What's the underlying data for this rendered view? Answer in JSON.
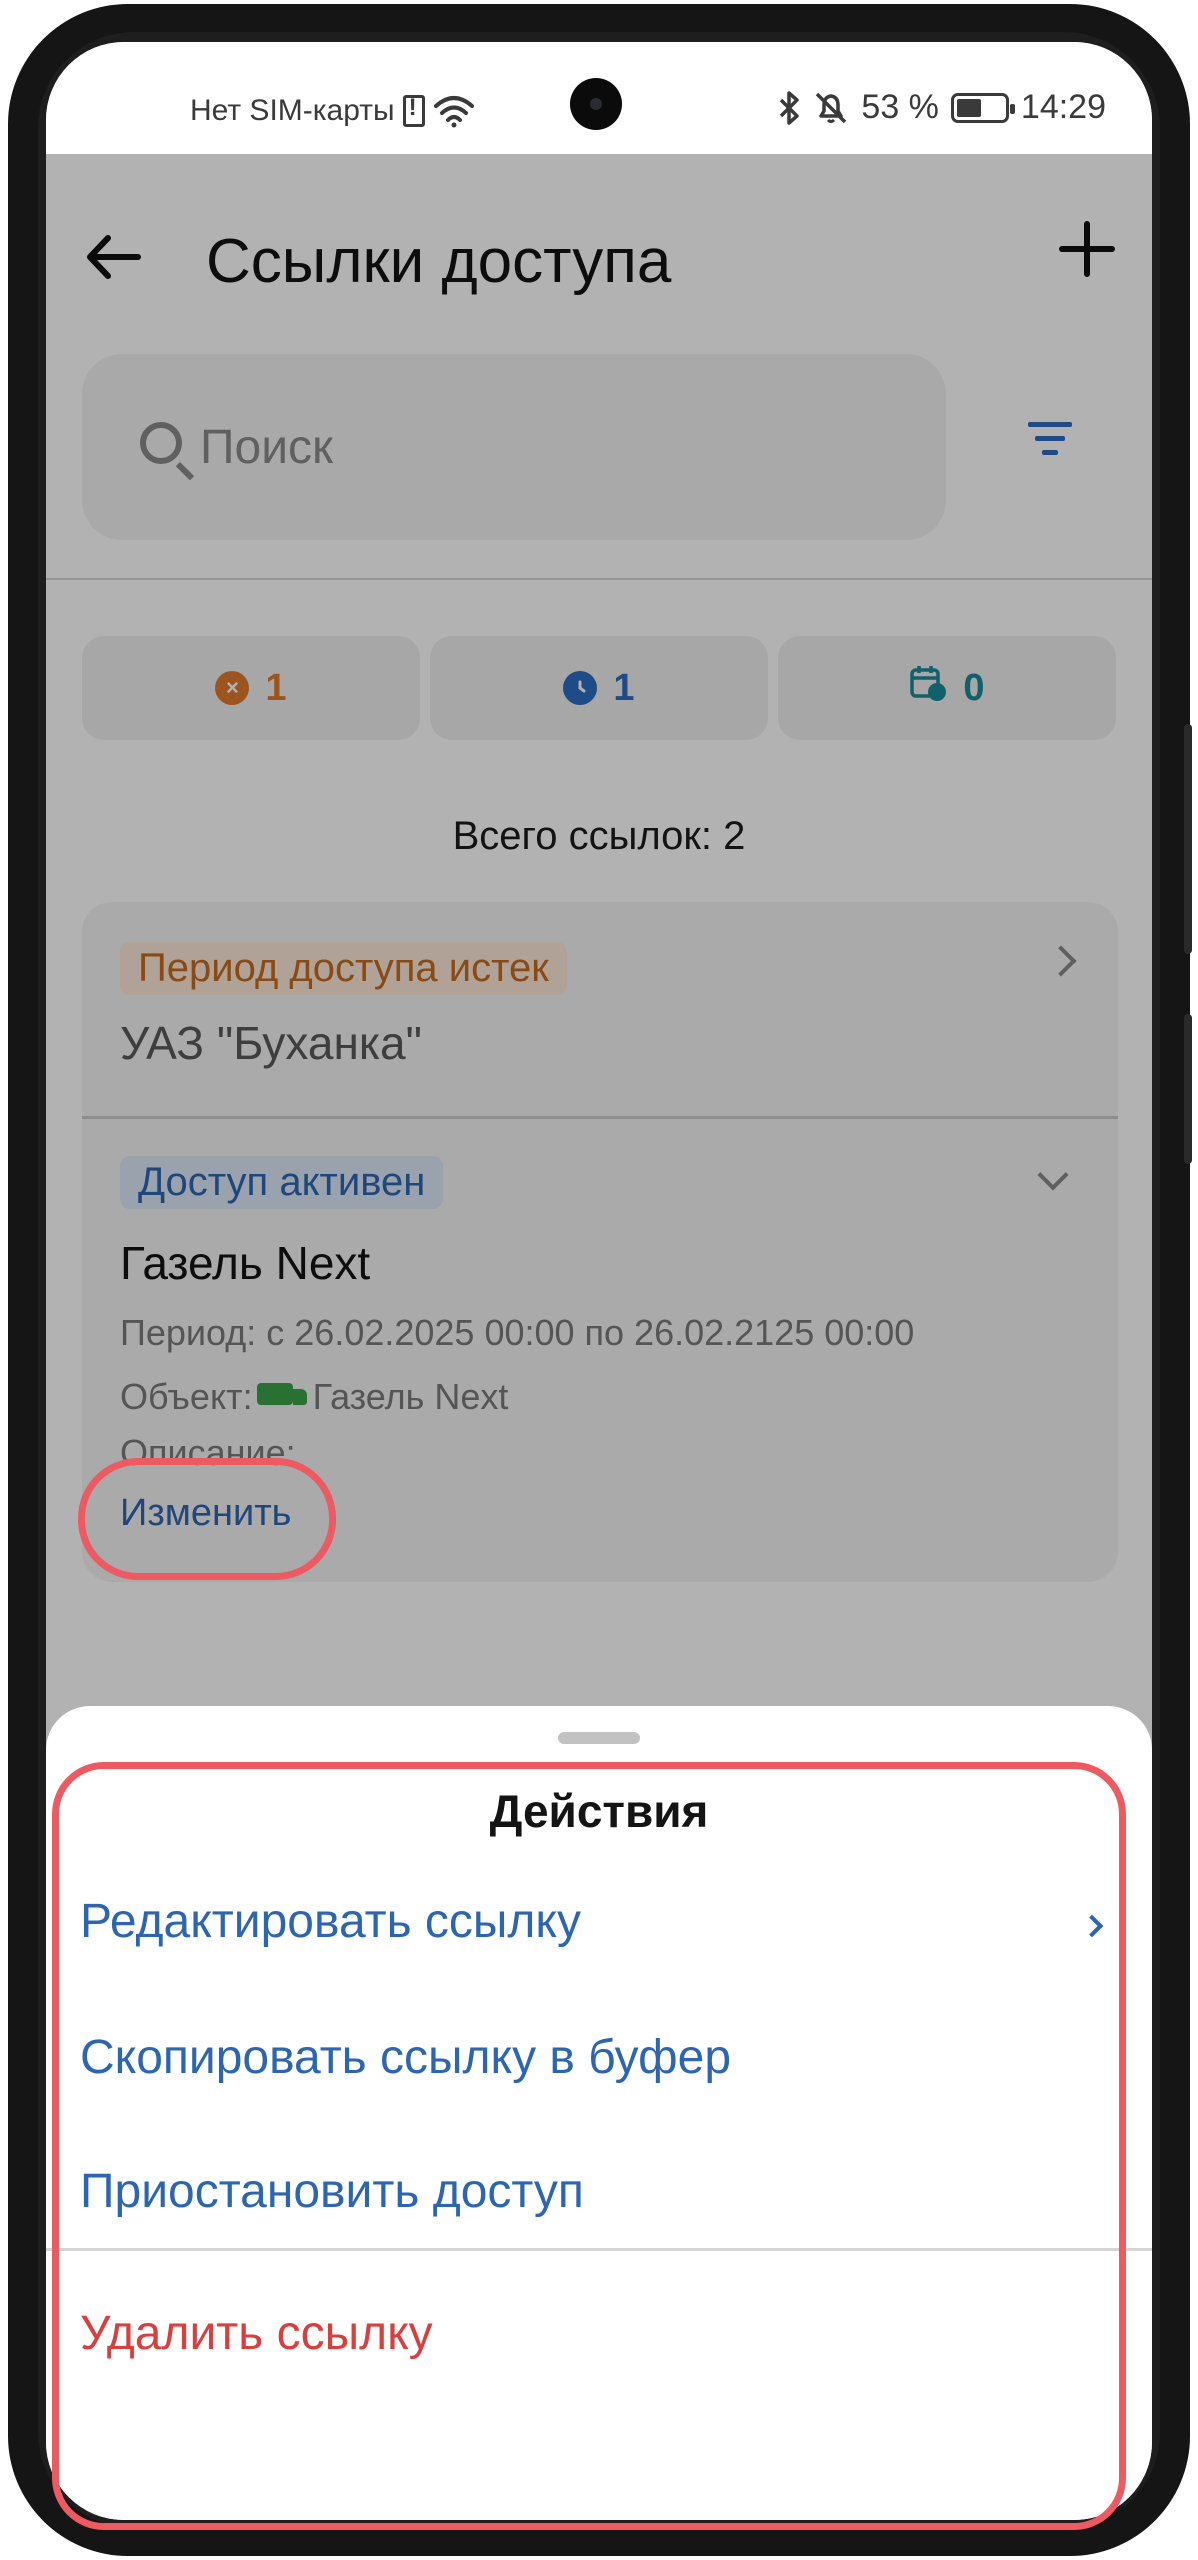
{
  "status_bar": {
    "carrier": "Нет SIM-карты",
    "battery": "53 %",
    "time": "14:29"
  },
  "header": {
    "title": "Ссылки доступа",
    "back_icon": "arrow-left-icon",
    "add_icon": "plus-icon"
  },
  "search": {
    "placeholder": "Поиск"
  },
  "counters": [
    {
      "icon": "x-circle-icon",
      "value": "1",
      "color": "#e07a2b"
    },
    {
      "icon": "clock-icon",
      "value": "1",
      "color": "#2d6cc0"
    },
    {
      "icon": "calendar-clock-icon",
      "value": "0",
      "color": "#1a8c98"
    }
  ],
  "total": "Всего ссылок: 2",
  "links": [
    {
      "status": "Период доступа истек",
      "name": "УАЗ \"Буханка\""
    },
    {
      "status": "Доступ активен",
      "name": "Газель Next",
      "period": "Период: с 26.02.2025 00:00 по 26.02.2125 00:00",
      "object_label": "Объект:",
      "object_name": "Газель Next",
      "description": "Описание:",
      "edit_label": "Изменить"
    }
  ],
  "sheet": {
    "title": "Действия",
    "actions": [
      {
        "label": "Редактировать ссылку"
      },
      {
        "label": "Скопировать ссылку в буфер"
      },
      {
        "label": "Приостановить доступ"
      },
      {
        "label": "Удалить ссылку"
      }
    ]
  }
}
